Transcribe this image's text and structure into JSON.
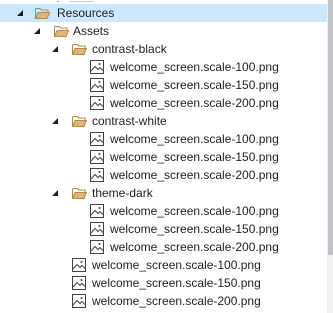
{
  "tree": {
    "rows": [
      {
        "label": "Resources",
        "type": "folder",
        "level": 1,
        "expanded": true,
        "selected": true,
        "icon": "folder-open-icon"
      },
      {
        "label": "Assets",
        "type": "folder",
        "level": 2,
        "expanded": true,
        "selected": false,
        "icon": "folder-open-icon"
      },
      {
        "label": "contrast-black",
        "type": "folder",
        "level": 3,
        "expanded": true,
        "selected": false,
        "icon": "folder-open-icon"
      },
      {
        "label": "welcome_screen.scale-100.png",
        "type": "image",
        "level": 4,
        "selected": false,
        "icon": "image-file-icon"
      },
      {
        "label": "welcome_screen.scale-150.png",
        "type": "image",
        "level": 4,
        "selected": false,
        "icon": "image-file-icon"
      },
      {
        "label": "welcome_screen.scale-200.png",
        "type": "image",
        "level": 4,
        "selected": false,
        "icon": "image-file-icon"
      },
      {
        "label": "contrast-white",
        "type": "folder",
        "level": 3,
        "expanded": true,
        "selected": false,
        "icon": "folder-open-icon"
      },
      {
        "label": "welcome_screen.scale-100.png",
        "type": "image",
        "level": 4,
        "selected": false,
        "icon": "image-file-icon"
      },
      {
        "label": "welcome_screen.scale-150.png",
        "type": "image",
        "level": 4,
        "selected": false,
        "icon": "image-file-icon"
      },
      {
        "label": "welcome_screen.scale-200.png",
        "type": "image",
        "level": 4,
        "selected": false,
        "icon": "image-file-icon"
      },
      {
        "label": "theme-dark",
        "type": "folder",
        "level": 3,
        "expanded": true,
        "selected": false,
        "icon": "folder-open-icon"
      },
      {
        "label": "welcome_screen.scale-100.png",
        "type": "image",
        "level": 4,
        "selected": false,
        "icon": "image-file-icon"
      },
      {
        "label": "welcome_screen.scale-150.png",
        "type": "image",
        "level": 4,
        "selected": false,
        "icon": "image-file-icon"
      },
      {
        "label": "welcome_screen.scale-200.png",
        "type": "image",
        "level": 4,
        "selected": false,
        "icon": "image-file-icon"
      },
      {
        "label": "welcome_screen.scale-100.png",
        "type": "image",
        "level": 3,
        "selected": false,
        "icon": "image-file-icon"
      },
      {
        "label": "welcome_screen.scale-150.png",
        "type": "image",
        "level": 3,
        "selected": false,
        "icon": "image-file-icon"
      },
      {
        "label": "welcome_screen.scale-200.png",
        "type": "image",
        "level": 3,
        "selected": false,
        "icon": "image-file-icon"
      }
    ]
  },
  "colors": {
    "selection_background": "#cce8ff",
    "folder_fill": "#dcb67a",
    "folder_stroke": "#b38a3e",
    "image_icon_stroke": "#424242",
    "text": "#1e1e1e",
    "expander": "#1e1e1e"
  }
}
